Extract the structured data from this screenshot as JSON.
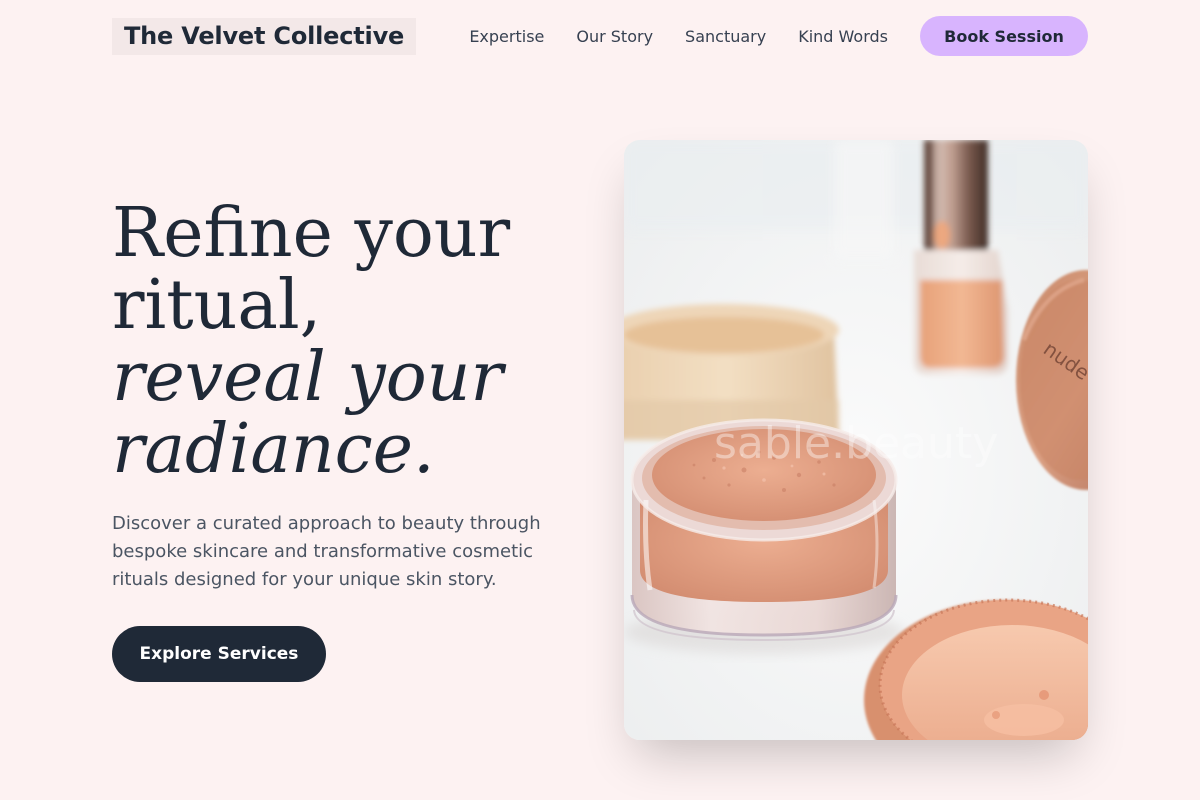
{
  "header": {
    "brand": "The Velvet Collective",
    "nav": [
      "Expertise",
      "Our Story",
      "Sanctuary",
      "Kind Words"
    ],
    "cta": "Book Session"
  },
  "hero": {
    "title_line1": "Refine your",
    "title_line2": "ritual,",
    "title_line3": "reveal your",
    "title_line4": "radiance.",
    "description": "Discover a curated approach to beauty through bespoke skincare and transformative cosmetic rituals designed for your unique skin story.",
    "cta": "Explore Services",
    "image": {
      "watermark": "sable.beauty",
      "jar_label": "nude"
    }
  },
  "colors": {
    "background": "#fdf2f2",
    "primary_dark": "#1f2937",
    "accent_purple": "#d8b4fe",
    "powder": "#e9a58a",
    "copper_lid": "#d08b6a"
  }
}
